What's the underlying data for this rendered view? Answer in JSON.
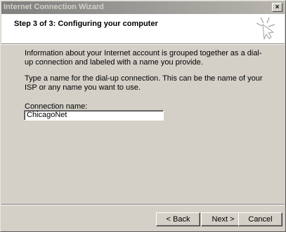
{
  "window": {
    "title": "Internet Connection Wizard",
    "close_glyph": "×"
  },
  "header": {
    "title": "Step 3 of 3: Configuring your computer"
  },
  "content": {
    "paragraph_1": "Information about your Internet account is grouped together as a dial-up connection and labeled with a name you provide.",
    "paragraph_2": "Type a name for the dial-up connection. This can be the name of your ISP or any name you want to use.",
    "connection_name_label": "Connection name:",
    "connection_name_value": "ChicagoNet"
  },
  "buttons": {
    "back": "< Back",
    "next": "Next >",
    "cancel": "Cancel"
  },
  "icons": {
    "wizard": "wizard-starburst-icon"
  }
}
